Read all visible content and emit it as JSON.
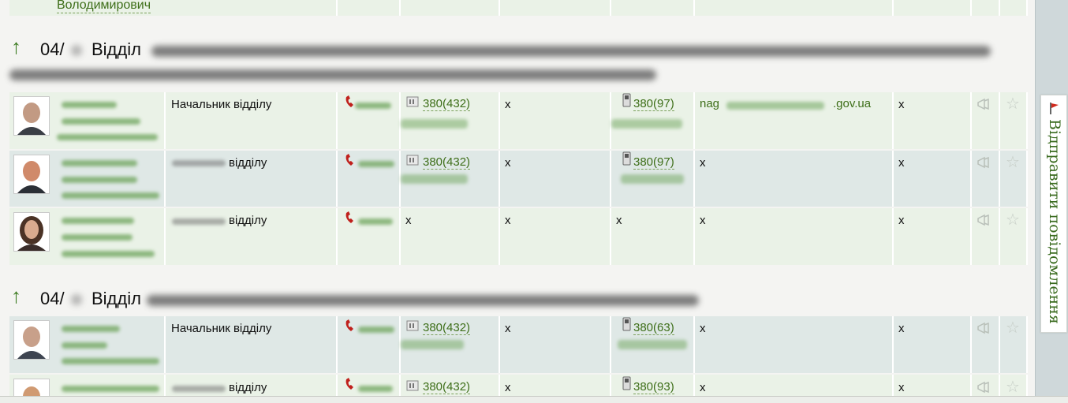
{
  "top_row": {
    "name_tail": "Володимирович"
  },
  "groups": [
    {
      "prefix": "04/",
      "title": "Відділ"
    },
    {
      "prefix": "04/",
      "title": "Відділ"
    }
  ],
  "rows": [
    {
      "position": "Начальник відділу",
      "fax": "380(432)",
      "fax2": "x",
      "mobile": "380(97)",
      "email_start": "nag",
      "email_end": ".gov.ua",
      "extra": "x"
    },
    {
      "position": "відділу",
      "fax": "380(432)",
      "fax2": "x",
      "mobile": "380(97)",
      "email": "x",
      "extra": "x"
    },
    {
      "position": "відділу",
      "fax": "x",
      "fax2": "x",
      "mobile": "x",
      "email": "x",
      "extra": "x"
    },
    {
      "position": "Начальник відділу",
      "fax": "380(432)",
      "fax2": "x",
      "mobile": "380(63)",
      "email": "x",
      "extra": "x"
    },
    {
      "position": "відділу",
      "fax": "380(432)",
      "fax2": "x",
      "mobile": "380(93)",
      "email": "x",
      "extra": "x"
    }
  ],
  "side_tab": {
    "label": "Відправити повідомлення"
  },
  "icons": {
    "back": "up-arrow-icon",
    "phone": "phone-icon",
    "fax": "fax-icon",
    "mobile": "mobile-phone-icon",
    "announce": "megaphone-icon",
    "favorite": "star-icon",
    "flag": "flag-icon"
  },
  "colors": {
    "link": "#3d6e18",
    "row_a": "#eaf2e7",
    "row_b": "#dfe8e6",
    "arrow": "#3a7a1e"
  }
}
